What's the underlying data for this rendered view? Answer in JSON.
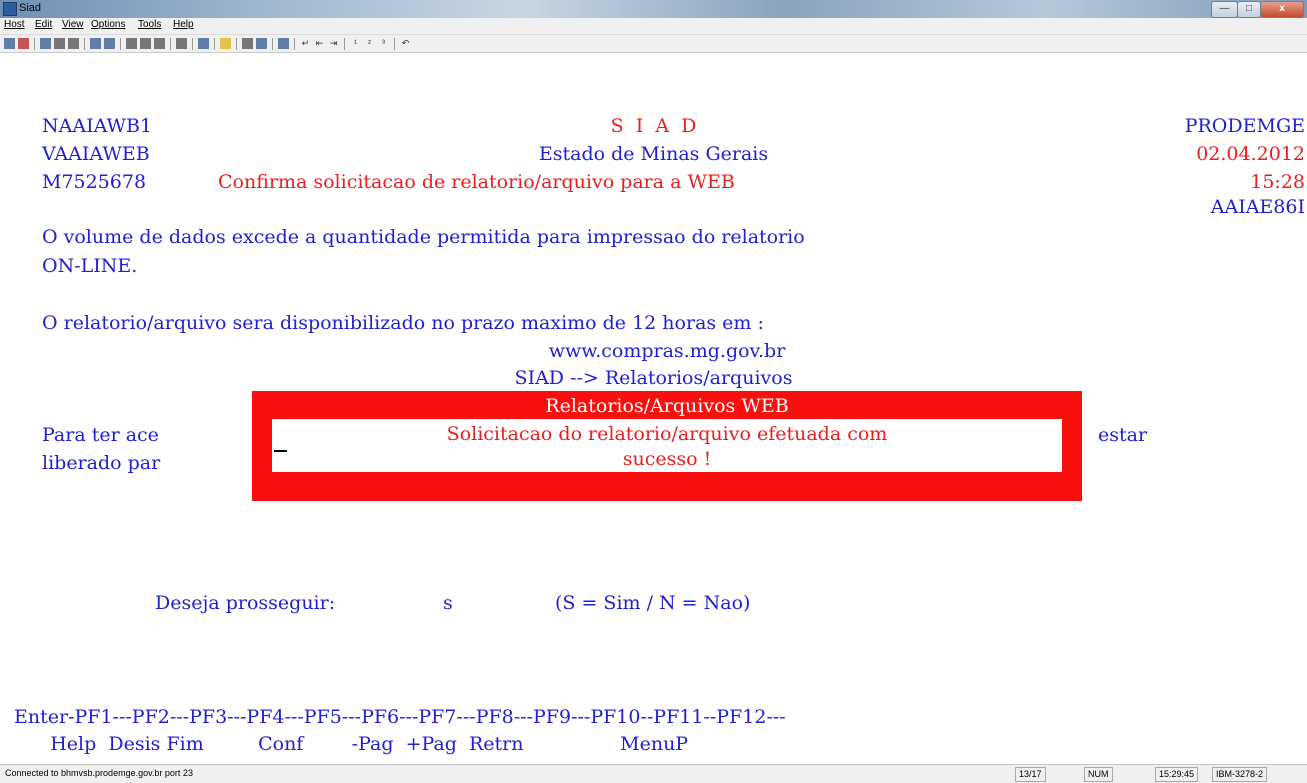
{
  "window": {
    "title": "Siad",
    "buttons": {
      "minimize": "—",
      "maximize": "□",
      "close": "x"
    }
  },
  "menu": [
    "Host",
    "Edit",
    "View",
    "Options",
    "Tools",
    "Help"
  ],
  "screen": {
    "header": {
      "left": [
        "NAAIAWB1",
        "VAAIAWEB",
        "M7525678"
      ],
      "center": [
        "S  I  A  D",
        "Estado de Minas Gerais",
        "Confirma solicitacao de relatorio/arquivo para a WEB"
      ],
      "right": [
        "PRODEMGE",
        "02.04.2012",
        "15:28",
        "AAIAE86I"
      ]
    },
    "message": {
      "line1": "O volume de dados excede a quantidade permitida para impressao do relatorio",
      "line2": "ON-LINE.",
      "line3": "O relatorio/arquivo sera disponibilizado no prazo maximo de 12 horas em :",
      "url": "www.compras.mg.gov.br",
      "path": "SIAD --> Relatorios/arquivos"
    },
    "access": {
      "left1": "Para ter ace",
      "left2": "liberado par",
      "right": "estar"
    },
    "popup": {
      "title": "Relatorios/Arquivos WEB",
      "line1": "Solicitacao do relatorio/arquivo efetuada com",
      "line2": "sucesso !"
    },
    "prompt": {
      "label": "Deseja prosseguir:",
      "value": "s",
      "hint": "(S = Sim / N = Nao)"
    },
    "pfkeys": {
      "line1": "Enter-PF1---PF2---PF3---PF4---PF5---PF6---PF7---PF8---PF9---PF10--PF11--PF12---",
      "line2": "      Help  Desis Fim         Conf        -Pag  +Pag  Retrn                MenuP"
    }
  },
  "status": {
    "connection": "Connected to bhmvsb.prodemge.gov.br port 23",
    "cursor_pos": "13/17",
    "num": "NUM",
    "time": "15:29:45",
    "model": "IBM-3278-2"
  }
}
